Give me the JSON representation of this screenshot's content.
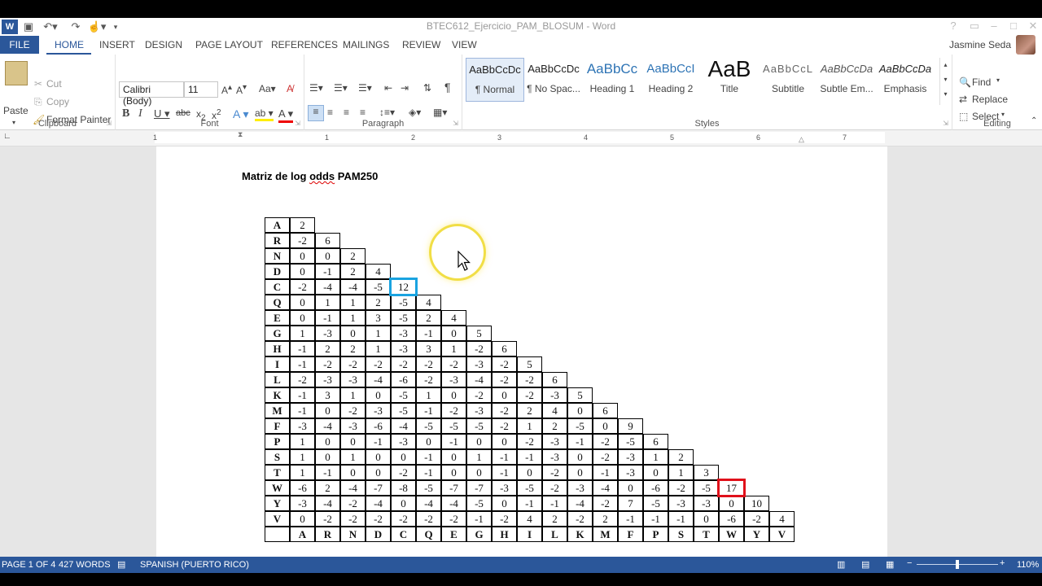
{
  "window": {
    "title": "BTEC612_Ejercicio_PAM_BLOSUM - Word",
    "user": "Jasmine Seda",
    "help": "?"
  },
  "tabs": [
    "FILE",
    "HOME",
    "INSERT",
    "DESIGN",
    "PAGE LAYOUT",
    "REFERENCES",
    "MAILINGS",
    "REVIEW",
    "VIEW"
  ],
  "clipboard": {
    "paste": "Paste",
    "cut": "Cut",
    "copy": "Copy",
    "format_painter": "Format Painter",
    "label": "Clipboard"
  },
  "font": {
    "name": "Calibri (Body)",
    "size": "11",
    "label": "Font"
  },
  "paragraph": {
    "label": "Paragraph"
  },
  "styles": {
    "label": "Styles",
    "items": [
      {
        "preview": "AaBbCcDc",
        "name": "¶ Normal"
      },
      {
        "preview": "AaBbCcDc",
        "name": "¶ No Spac..."
      },
      {
        "preview": "AaBbCc",
        "name": "Heading 1"
      },
      {
        "preview": "AaBbCcI",
        "name": "Heading 2"
      },
      {
        "preview": "AaB",
        "name": "Title"
      },
      {
        "preview": "AaBbCcL",
        "name": "Subtitle"
      },
      {
        "preview": "AaBbCcDa",
        "name": "Subtle Em..."
      },
      {
        "preview": "AaBbCcDa",
        "name": "Emphasis"
      }
    ]
  },
  "editing": {
    "find": "Find",
    "replace": "Replace",
    "select": "Select",
    "label": "Editing"
  },
  "ruler": [
    "1",
    "1",
    "2",
    "3",
    "4",
    "5",
    "6",
    "7"
  ],
  "document": {
    "heading_pre": "Matriz de log ",
    "heading_sq": "odds",
    "heading_post": " PAM250",
    "row_labels": [
      "A",
      "R",
      "N",
      "D",
      "C",
      "Q",
      "E",
      "G",
      "H",
      "I",
      "L",
      "K",
      "M",
      "F",
      "P",
      "S",
      "T",
      "W",
      "Y",
      "V"
    ],
    "rows": [
      [
        "2"
      ],
      [
        "-2",
        "6"
      ],
      [
        "0",
        "0",
        "2"
      ],
      [
        "0",
        "-1",
        "2",
        "4"
      ],
      [
        "-2",
        "-4",
        "-4",
        "-5",
        "12"
      ],
      [
        "0",
        "1",
        "1",
        "2",
        "-5",
        "4"
      ],
      [
        "0",
        "-1",
        "1",
        "3",
        "-5",
        "2",
        "4"
      ],
      [
        "1",
        "-3",
        "0",
        "1",
        "-3",
        "-1",
        "0",
        "5"
      ],
      [
        "-1",
        "2",
        "2",
        "1",
        "-3",
        "3",
        "1",
        "-2",
        "6"
      ],
      [
        "-1",
        "-2",
        "-2",
        "-2",
        "-2",
        "-2",
        "-2",
        "-3",
        "-2",
        "5"
      ],
      [
        "-2",
        "-3",
        "-3",
        "-4",
        "-6",
        "-2",
        "-3",
        "-4",
        "-2",
        "-2",
        "6"
      ],
      [
        "-1",
        "3",
        "1",
        "0",
        "-5",
        "1",
        "0",
        "-2",
        "0",
        "-2",
        "-3",
        "5"
      ],
      [
        "-1",
        "0",
        "-2",
        "-3",
        "-5",
        "-1",
        "-2",
        "-3",
        "-2",
        "2",
        "4",
        "0",
        "6"
      ],
      [
        "-3",
        "-4",
        "-3",
        "-6",
        "-4",
        "-5",
        "-5",
        "-5",
        "-2",
        "1",
        "2",
        "-5",
        "0",
        "9"
      ],
      [
        "1",
        "0",
        "0",
        "-1",
        "-3",
        "0",
        "-1",
        "0",
        "0",
        "-2",
        "-3",
        "-1",
        "-2",
        "-5",
        "6"
      ],
      [
        "1",
        "0",
        "1",
        "0",
        "0",
        "-1",
        "0",
        "1",
        "-1",
        "-1",
        "-3",
        "0",
        "-2",
        "-3",
        "1",
        "2"
      ],
      [
        "1",
        "-1",
        "0",
        "0",
        "-2",
        "-1",
        "0",
        "0",
        "-1",
        "0",
        "-2",
        "0",
        "-1",
        "-3",
        "0",
        "1",
        "3"
      ],
      [
        "-6",
        "2",
        "-4",
        "-7",
        "-8",
        "-5",
        "-7",
        "-7",
        "-3",
        "-5",
        "-2",
        "-3",
        "-4",
        "0",
        "-6",
        "-2",
        "-5",
        "17"
      ],
      [
        "-3",
        "-4",
        "-2",
        "-4",
        "0",
        "-4",
        "-4",
        "-5",
        "0",
        "-1",
        "-1",
        "-4",
        "-2",
        "7",
        "-5",
        "-3",
        "-3",
        "0",
        "10"
      ],
      [
        "0",
        "-2",
        "-2",
        "-2",
        "-2",
        "-2",
        "-2",
        "-1",
        "-2",
        "4",
        "2",
        "-2",
        "2",
        "-1",
        "-1",
        "-1",
        "0",
        "-6",
        "-2",
        "4"
      ]
    ],
    "col_labels": [
      "A",
      "R",
      "N",
      "D",
      "C",
      "Q",
      "E",
      "G",
      "H",
      "I",
      "L",
      "K",
      "M",
      "F",
      "P",
      "S",
      "T",
      "W",
      "Y",
      "V"
    ],
    "highlights": [
      {
        "row": 4,
        "col": 4,
        "color": "#1aa3e0"
      },
      {
        "row": 17,
        "col": 17,
        "color": "#e0101a"
      }
    ]
  },
  "status": {
    "page": "PAGE 1 OF 4",
    "words": "427 WORDS",
    "language": "SPANISH (PUERTO RICO)",
    "zoom": "110%"
  },
  "colors": {
    "accent": "#2b579a",
    "cursor_ring": "#f0dc3c"
  }
}
